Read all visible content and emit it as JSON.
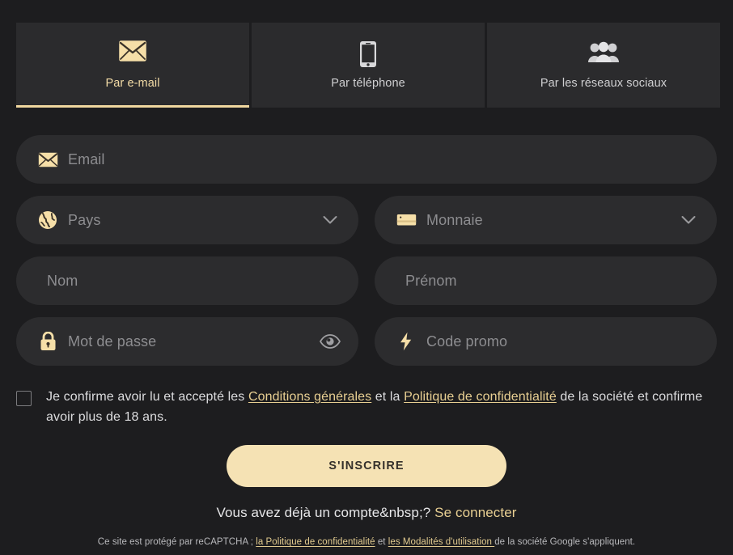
{
  "theme": {
    "page_bg": "#1d1d1f",
    "panel_bg": "#2b2b2d",
    "field_bg": "#2c2c2e",
    "accent": "#f0d79f",
    "accent_button": "#f5e2b4",
    "link": "#e8cf92",
    "placeholder": "#8d8d90",
    "text": "#dcdcde"
  },
  "tabs": [
    {
      "id": "email",
      "label": "Par e-mail",
      "icon": "envelope-icon",
      "active": true
    },
    {
      "id": "phone",
      "label": "Par téléphone",
      "icon": "mobile-phone-icon",
      "active": false
    },
    {
      "id": "social",
      "label": "Par les réseaux sociaux",
      "icon": "people-group-icon",
      "active": false
    }
  ],
  "form": {
    "email": {
      "placeholder": "Email",
      "value": "",
      "icon": "envelope-icon"
    },
    "country": {
      "placeholder": "Pays",
      "value": "",
      "icon": "globe-icon",
      "chevron": "chevron-down-icon"
    },
    "currency": {
      "placeholder": "Monnaie",
      "value": "",
      "icon": "banknote-icon",
      "chevron": "chevron-down-icon"
    },
    "lastname": {
      "placeholder": "Nom",
      "value": ""
    },
    "firstname": {
      "placeholder": "Prénom",
      "value": ""
    },
    "password": {
      "placeholder": "Mot de passe",
      "value": "",
      "icon": "lock-icon",
      "toggle": "eye-icon"
    },
    "promo": {
      "placeholder": "Code promo",
      "value": "",
      "icon": "lightning-bolt-icon"
    }
  },
  "terms": {
    "checked": false,
    "part1": "Je confirme avoir lu et accepté les ",
    "link1": "Conditions générales",
    "part2": " et la ",
    "link2": "Politique de confidentialité",
    "part3": " de la société et confirme avoir plus de 18 ans."
  },
  "submit": {
    "label": "S'INSCRIRE"
  },
  "login": {
    "prompt": "Vous avez déjà un compte&nbsp;?",
    "link": "Se connecter"
  },
  "captcha": {
    "part1": "Ce site est protégé par reCAPTCHA ; ",
    "link1": "la Politique de confidentialité",
    "part2": " et ",
    "link2": "les Modalités d'utilisation ",
    "part3": "de la société Google s'appliquent."
  }
}
